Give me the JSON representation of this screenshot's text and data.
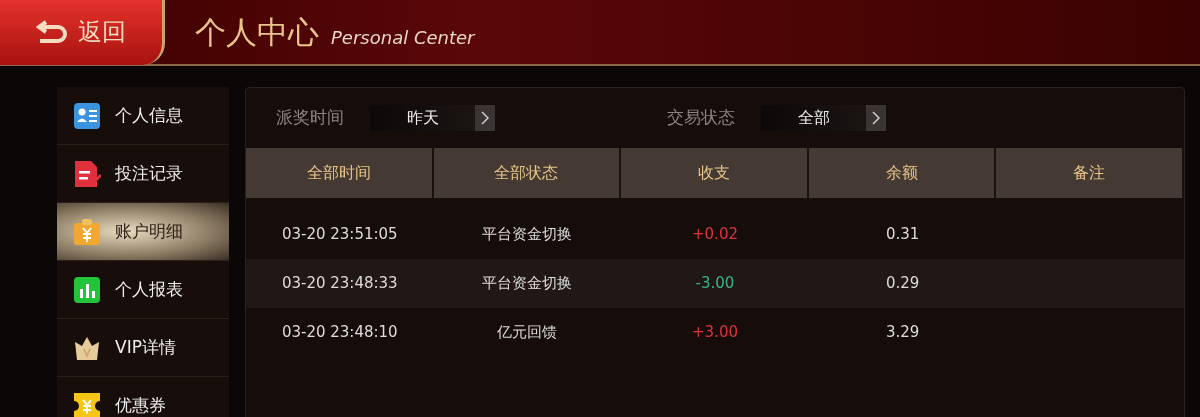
{
  "header": {
    "back": "返回",
    "title": "个人中心",
    "subtitle": "Personal Center"
  },
  "sidebar": {
    "items": [
      {
        "label": "个人信息",
        "selected": false
      },
      {
        "label": "投注记录",
        "selected": false
      },
      {
        "label": "账户明细",
        "selected": true
      },
      {
        "label": "个人报表",
        "selected": false
      },
      {
        "label": "VIP详情",
        "selected": false
      },
      {
        "label": "优惠券",
        "selected": false
      }
    ]
  },
  "filters": [
    {
      "label": "派奖时间",
      "value": "昨天"
    },
    {
      "label": "交易状态",
      "value": "全部"
    }
  ],
  "table": {
    "columns": [
      "全部时间",
      "全部状态",
      "收支",
      "余额",
      "备注"
    ],
    "rows": [
      {
        "time": "03-20 23:51:05",
        "status": "平台资金切换",
        "amount": "+0.02",
        "kind": "income",
        "balance": "0.31"
      },
      {
        "time": "03-20 23:48:33",
        "status": "平台资金切换",
        "amount": "-3.00",
        "kind": "expense",
        "balance": "0.29"
      },
      {
        "time": "03-20 23:48:10",
        "status": "亿元回馈",
        "amount": "+3.00",
        "kind": "income",
        "balance": "3.29"
      }
    ]
  }
}
